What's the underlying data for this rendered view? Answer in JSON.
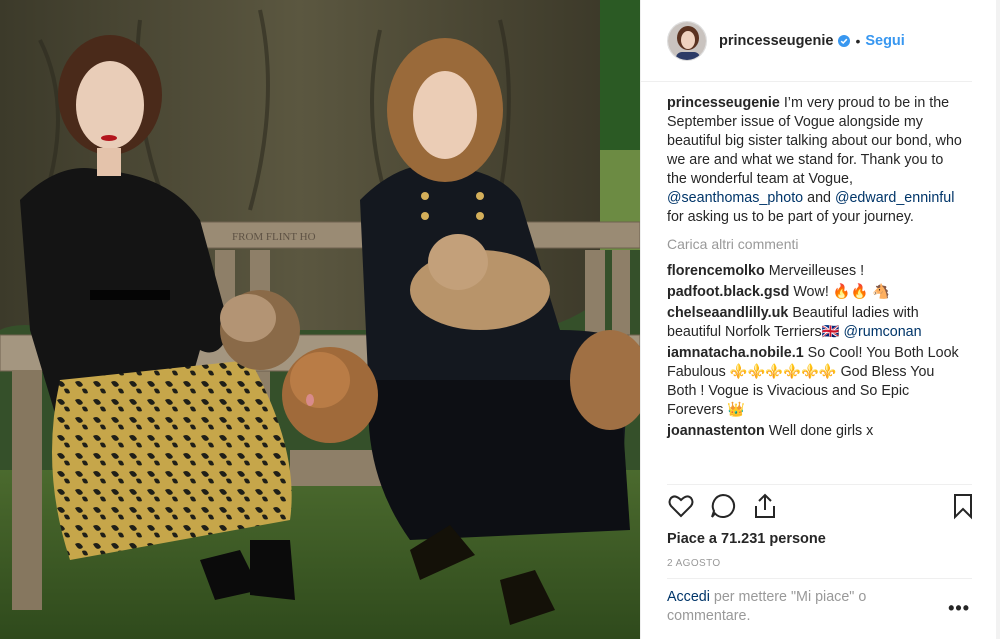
{
  "header": {
    "username": "princesseugenie",
    "dot": "•",
    "follow_label": "Segui"
  },
  "caption": {
    "username": "princesseugenie",
    "text_1": "I’m very proud to be in the September issue of Vogue alongside my beautiful big sister talking about our bond, who we are and what we stand for. Thank you to the wonderful team at Vogue, ",
    "mention_1": "@seanthomas_photo",
    "text_2": " and ",
    "mention_2": "@edward_enninful",
    "text_3": " for asking us to be part of your journey."
  },
  "load_more_label": "Carica altri commenti",
  "comments": [
    {
      "username": "florencemolko",
      "text": "Merveilleuses !"
    },
    {
      "username": "padfoot.black.gsd",
      "text": "Wow! 🔥🔥 🐴"
    },
    {
      "username": "chelseaandlilly.uk",
      "text": "Beautiful ladies with beautiful Norfolk Terriers🇬🇧",
      "mention": "@rumconan"
    },
    {
      "username": "iamnatacha.nobile.1",
      "text": "So Cool! You Both Look Fabulous ⚜️⚜️⚜️⚜️⚜️⚜️ God Bless You Both ! Vogue is Vivacious and So Epic Forevers 👑"
    },
    {
      "username": "joannastenton",
      "text": "Well done girls x"
    }
  ],
  "icons": {
    "like": "heart-icon",
    "comment": "comment-icon",
    "share": "share-icon",
    "save": "bookmark-icon",
    "verified": "verified-badge-icon",
    "options": "more-options-icon"
  },
  "likes_label": "Piace a 71.231 persone",
  "date_label": "2 AGOSTO",
  "login_prompt": {
    "link": "Accedi",
    "text": " per mettere \"Mi piace\" o commentare.",
    "options": "•••"
  },
  "colors": {
    "accent": "#3897f0",
    "mention": "#003569",
    "muted": "#999999"
  }
}
